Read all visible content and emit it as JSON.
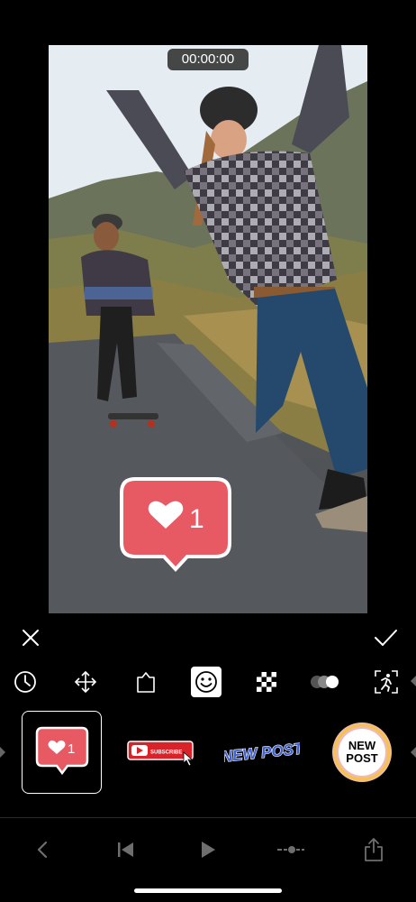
{
  "preview": {
    "timecode": "00:00:00",
    "overlay_sticker": {
      "type": "like-bubble",
      "count": "1",
      "color": "#e85a63"
    }
  },
  "toolbar": {
    "close_icon": "close-icon",
    "confirm_icon": "check-icon"
  },
  "tools": [
    {
      "name": "timer-tool",
      "icon": "clock-icon"
    },
    {
      "name": "move-tool",
      "icon": "move-arrows-icon"
    },
    {
      "name": "shape-tool",
      "icon": "tag-shape-icon"
    },
    {
      "name": "sticker-tool",
      "icon": "smiley-icon",
      "active": true
    },
    {
      "name": "transparency-tool",
      "icon": "checkerboard-icon"
    },
    {
      "name": "blend-tool",
      "icon": "toggle-circles-icon"
    },
    {
      "name": "motion-track-tool",
      "icon": "running-figure-icon"
    }
  ],
  "stickers": [
    {
      "name": "like-sticker",
      "text": "1",
      "selected": true
    },
    {
      "name": "subscribe-sticker",
      "text": "SUBSCRIBE"
    },
    {
      "name": "new-post-text-sticker",
      "text": "NEW POST"
    },
    {
      "name": "new-post-badge-sticker",
      "text": "NEW POST"
    }
  ],
  "colors": {
    "like_red": "#e85a63",
    "subscribe_red": "#d8232a",
    "newpost_blue": "#3f5fcf"
  }
}
